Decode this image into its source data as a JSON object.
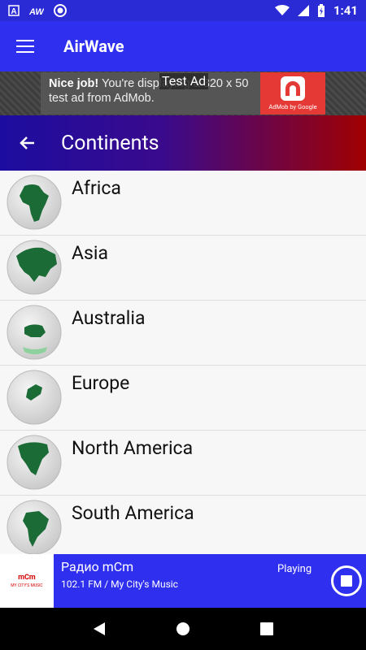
{
  "statusbar": {
    "time": "1:41",
    "icons": [
      "a-letter-icon",
      "aw-app-icon",
      "circle-notification-icon",
      "wifi-icon",
      "signal-icon",
      "battery-charging-icon"
    ]
  },
  "appbar": {
    "title": "AirWave",
    "menu_icon": "hamburger-menu-icon"
  },
  "ad": {
    "label": "Test Ad",
    "headline": "Nice job!",
    "body": "You're displaying a 320 x 50 test ad from AdMob.",
    "brand": "AdMob by Google"
  },
  "section": {
    "title": "Continents",
    "back_icon": "back-arrow-icon"
  },
  "continents": [
    {
      "label": "Africa"
    },
    {
      "label": "Asia"
    },
    {
      "label": "Australia"
    },
    {
      "label": "Europe"
    },
    {
      "label": "North America"
    },
    {
      "label": "South America"
    }
  ],
  "player": {
    "station_name": "Радио mCm",
    "station_desc": "102.1 FM / My City's Music",
    "status": "Playing",
    "logo_text": "mCm",
    "logo_sub": "MY CITY'S MUSIC",
    "stop_icon": "stop-icon"
  },
  "navbar": {
    "icons": [
      "back-triangle-icon",
      "home-circle-icon",
      "recents-square-icon"
    ]
  },
  "colors": {
    "primary": "#2f2ff0",
    "header_start": "#1c0da0",
    "header_end": "#a00000",
    "land": "#1b6b36",
    "globe": "#e0e0e0"
  }
}
